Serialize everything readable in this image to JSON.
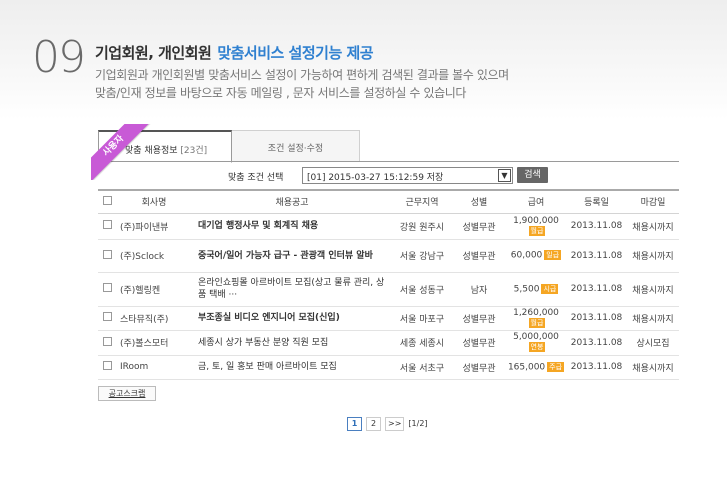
{
  "hero": {
    "number": "09",
    "title": "기업회원, 개인회원",
    "title_accent": "맞춤서비스 설정기능 제공",
    "desc_line1": "기업회원과 개인회원별 맞춤서비스 설정이 가능하여 편하게 검색된 결과를 볼수 있으며",
    "desc_line2": "맞춤/인재 정보를 바탕으로 자동 메일링 , 문자 서비스를 설정하실 수 있습니다"
  },
  "ribbon": {
    "label": "사용자"
  },
  "tabs": {
    "active_label": "맞춤 채용정보",
    "active_count": "[23건]",
    "inactive_label": "조건 설정·수정"
  },
  "filter": {
    "label": "맞춤 조건 선택",
    "selected": "[01] 2015-03-27 15:12:59 저장",
    "search_label": "검색"
  },
  "table": {
    "headers": {
      "company": "회사명",
      "title": "채용공고",
      "region": "근무지역",
      "gender": "성별",
      "salary": "급여",
      "registered": "등록일",
      "deadline": "마감일"
    },
    "rows": [
      {
        "company": "(주)파이낸뷰",
        "title": "대기업 행정사무 및 회계직 채용",
        "region": "강원 원주시",
        "gender": "성별무관",
        "salary": "1,900,000",
        "tag": "월급",
        "registered": "2013.11.08",
        "deadline": "채용시까지"
      },
      {
        "company": "(주)Sclock",
        "title": "중국어/일어 가능자 급구 - 관광객 인터뷰 알바",
        "region": "서울 강남구",
        "gender": "성별무관",
        "salary": "60,000",
        "tag": "일급",
        "registered": "2013.11.08",
        "deadline": "채용시까지"
      },
      {
        "company": "(주)헬링켄",
        "title": "온라인쇼핑몰 아르바이트 모집(상고 물류 관리, 상품 택배 ···",
        "region": "서울 성동구",
        "gender": "남자",
        "salary": "5,500",
        "tag": "시급",
        "registered": "2013.11.08",
        "deadline": "채용시까지"
      },
      {
        "company": "스타뮤직(주)",
        "title": "부조종실 비디오 엔지니어 모집(신입)",
        "region": "서울 마포구",
        "gender": "성별무관",
        "salary": "1,260,000",
        "tag": "월급",
        "registered": "2013.11.08",
        "deadline": "채용시까지"
      },
      {
        "company": "(주)볼스모터",
        "title": "세종시 상가 부동산 분양 직원 모집",
        "region": "세종 세종시",
        "gender": "성별무관",
        "salary": "5,000,000",
        "tag": "연봉",
        "registered": "2013.11.08",
        "deadline": "상시모집"
      },
      {
        "company": "IRoom",
        "title": "금, 토, 일 홍보 판매 아르바이트 모집",
        "region": "서울 서초구",
        "gender": "성별무관",
        "salary": "165,000",
        "tag": "주급",
        "registered": "2013.11.08",
        "deadline": "채용시까지"
      }
    ]
  },
  "scrap_label": "공고스크랩",
  "pager": {
    "page1": "1",
    "page2": "2",
    "next": ">>",
    "info": "[1/2]"
  },
  "colors": {
    "accent": "#2f80d0",
    "ribbon": "#c85ad6",
    "tag": "#f5a623"
  }
}
